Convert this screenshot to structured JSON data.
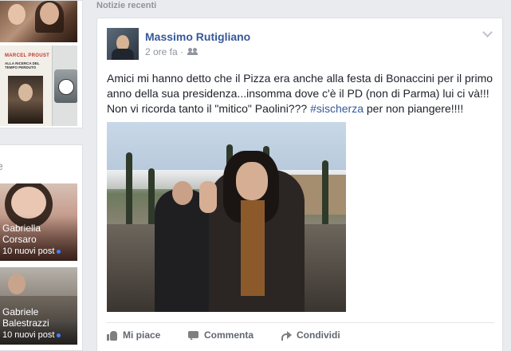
{
  "feed": {
    "section_title": "Notizie recenti"
  },
  "left": {
    "book": {
      "author": "MARCEL PROUST",
      "title": "ALLA RICERCA DEL TEMPO PERDUTO"
    },
    "friends_label": "e",
    "friends": [
      {
        "name": "Gabriella Corsaro",
        "posts": "10 nuovi post"
      },
      {
        "name": "Gabriele Balestrazzi",
        "posts": "10 nuovi post"
      }
    ]
  },
  "post": {
    "author": "Massimo Rutigliano",
    "time": "2 ore fa",
    "separator": "·",
    "audience_icon": "friends-icon",
    "text_before": "Amici mi hanno detto che il Pizza era anche alla festa di Bonaccini per il primo anno della sua presidenza...insomma dove c'è il PD (non di Parma) lui ci và!!! Non vi ricorda tanto il \"mitico\" Paolini??? ",
    "hashtag": "#sischerza",
    "text_after": " per non piangere!!!!",
    "actions": {
      "like": "Mi piace",
      "comment": "Commenta",
      "share": "Condividi"
    }
  },
  "colors": {
    "link": "#365899",
    "muted": "#90949c",
    "background": "#e9ebee",
    "unread_dot": "#4080ff"
  }
}
